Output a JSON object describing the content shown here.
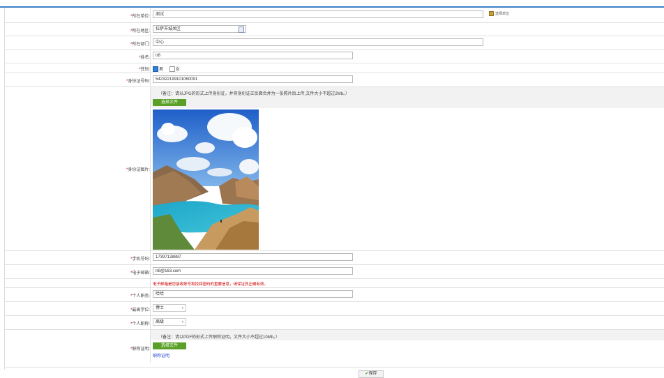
{
  "form": {
    "unit": {
      "label": "所在单位:",
      "value": "测试",
      "action": "选择单位"
    },
    "area": {
      "label": "所在地区:",
      "value": "拉萨市城关区"
    },
    "dept": {
      "label": "所在部门:",
      "value": "中心"
    },
    "name": {
      "label": "姓名:",
      "value": "tr8"
    },
    "gender": {
      "label": "性别:",
      "male": "男",
      "female": "女",
      "selected": "男"
    },
    "idno": {
      "label": "身份证号码:",
      "value": "542322199101060091"
    },
    "idphoto": {
      "label": "身份证图片:",
      "note": "（备注：请以JPG的形式上传身份证，并将身份证正反面合并为一张照片后上传,文件大小不超过2Mb。）",
      "button": "选择文件"
    },
    "phone": {
      "label": "手机号码:",
      "value": "17397138887"
    },
    "email": {
      "label": "电子邮箱:",
      "value": "tr8@163.com",
      "warning": "电子邮箱是您接收账号和找回密码的重要信息，请保证其正确有效。"
    },
    "position": {
      "label": "个人职务:",
      "value": "哈哈"
    },
    "degree": {
      "label": "最高学位:",
      "value": "博士"
    },
    "title": {
      "label": "个人职称:",
      "value": "高级"
    },
    "cert": {
      "label": "职称证明:",
      "note": "（备注：请以PDF的形式上传职称证明，文件大小不超过10Mb。）",
      "button": "选择文件",
      "link": "职称证明"
    },
    "save": "保存"
  },
  "colors": {
    "accent": "#3a7fc6",
    "button": "#5aa028",
    "required": "#d00000",
    "link": "#1a3fcc"
  }
}
